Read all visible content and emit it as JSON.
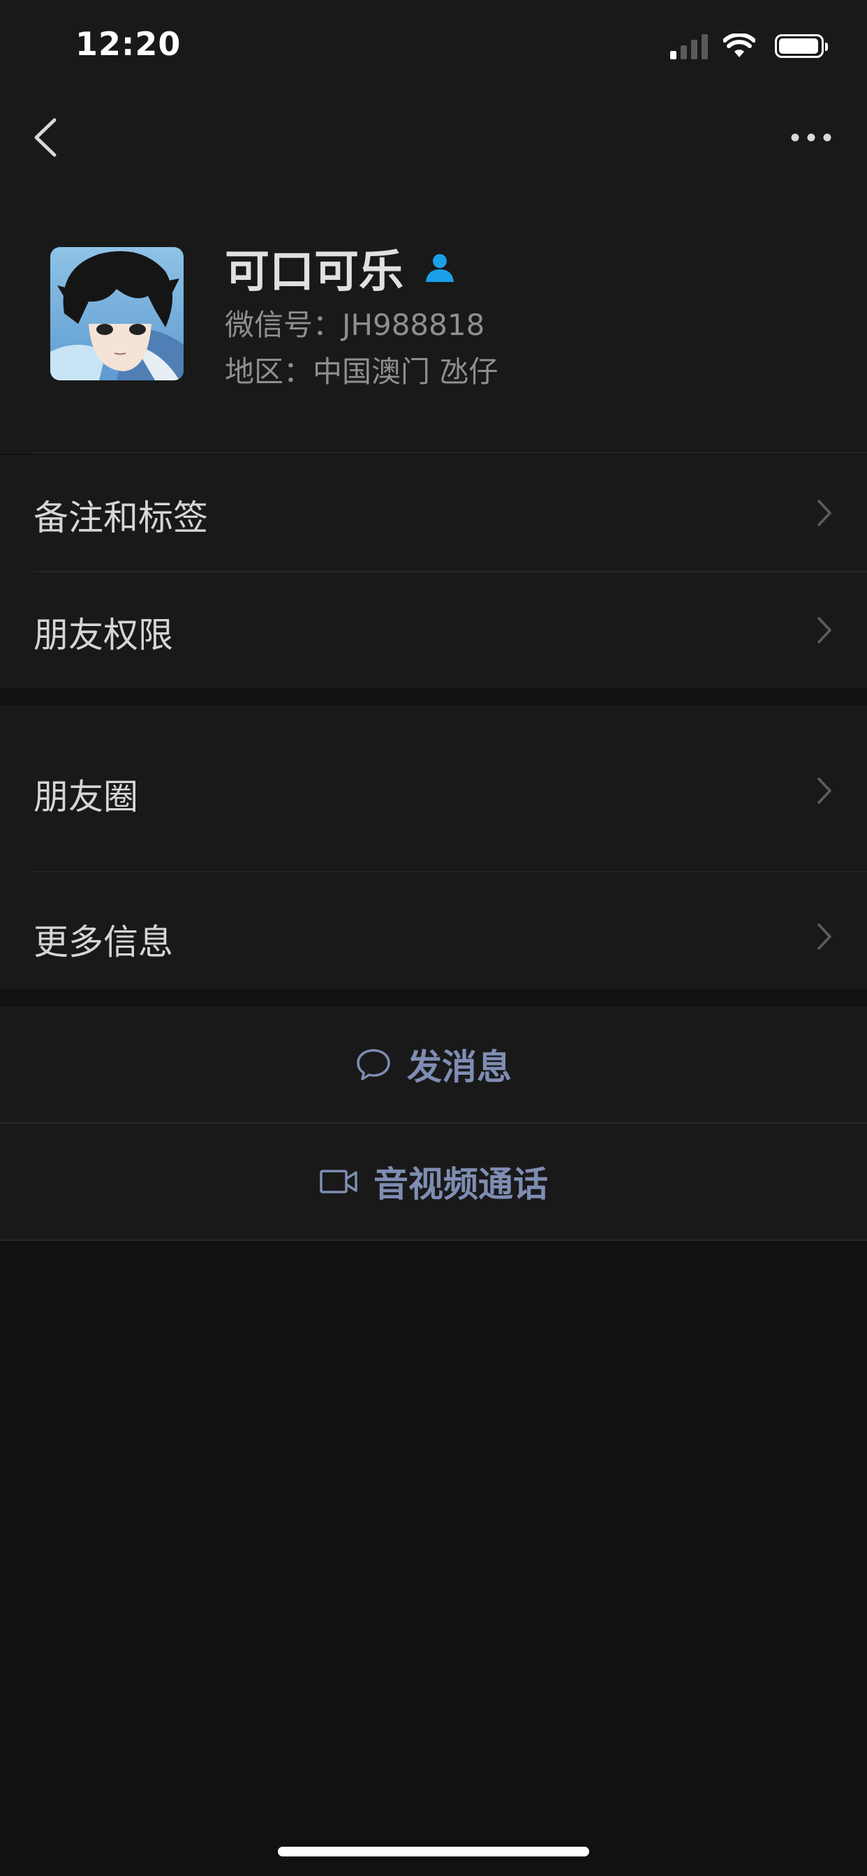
{
  "status_bar": {
    "time": "12:20",
    "icons": [
      "signal-icon",
      "wifi-icon",
      "battery-icon"
    ],
    "signal_bars_active": 1,
    "battery_level": 0.9
  },
  "nav": {
    "back_icon": "chevron-left-icon",
    "more_icon": "more-horizontal-icon"
  },
  "profile": {
    "name": "可口可乐",
    "badge_icon": "friend-person-icon",
    "wechat_id": "微信号：JH988818",
    "region": "地区：中国澳门 氹仔"
  },
  "menu_group_1": [
    {
      "label": "备注和标签"
    },
    {
      "label": "朋友权限"
    }
  ],
  "menu_group_2": [
    {
      "label": "朋友圈"
    },
    {
      "label": "更多信息"
    }
  ],
  "actions": {
    "message_label": "发消息",
    "message_icon": "chat-bubble-icon",
    "call_label": "音视频通话",
    "call_icon": "video-camera-icon"
  },
  "colors": {
    "background": "#111111",
    "surface": "#191919",
    "action_text": "#7f8db3",
    "badge_blue": "#1aa0e6"
  }
}
